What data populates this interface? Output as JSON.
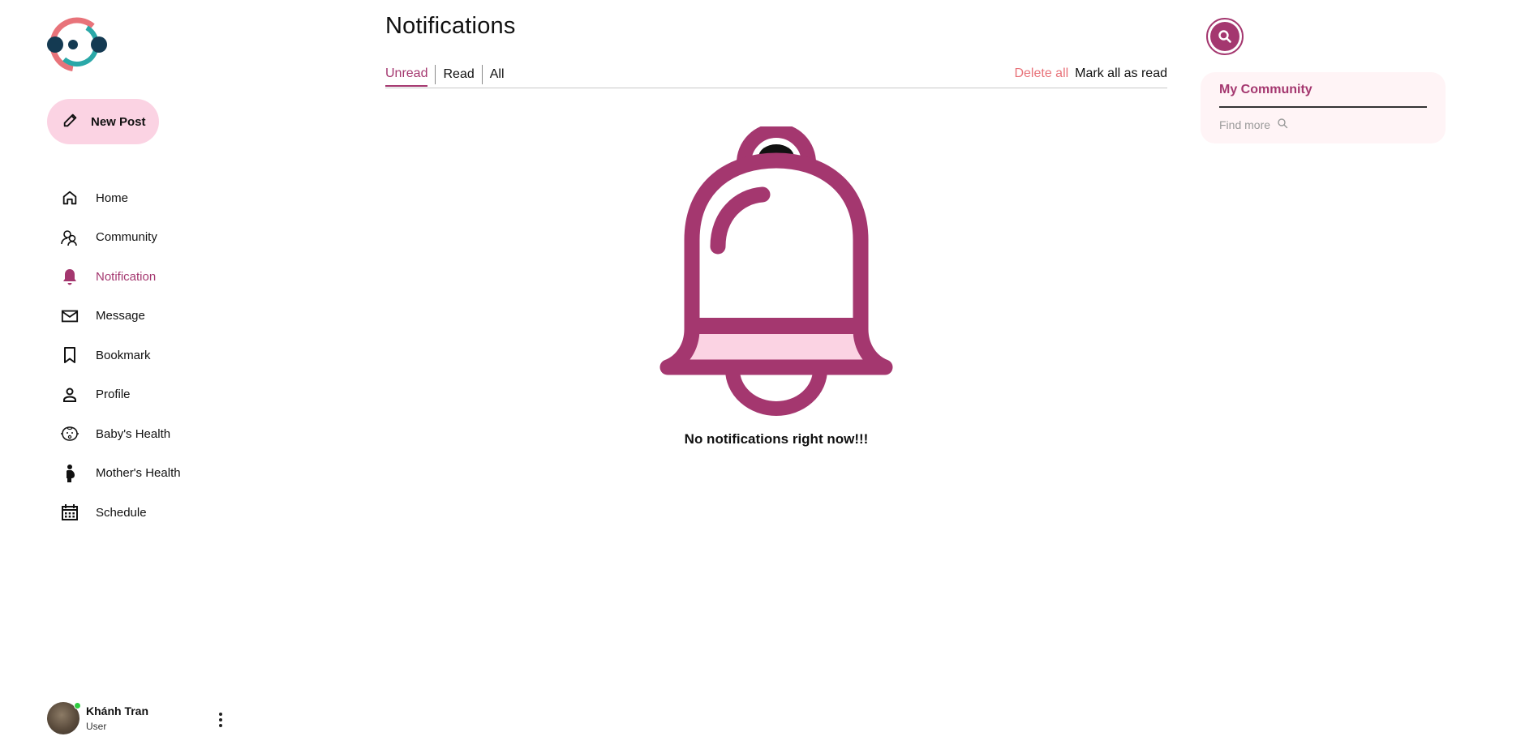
{
  "sidebar": {
    "new_post_label": "New Post",
    "items": [
      {
        "label": "Home",
        "icon": "home-icon"
      },
      {
        "label": "Community",
        "icon": "community-icon"
      },
      {
        "label": "Notification",
        "icon": "bell-icon",
        "active": true
      },
      {
        "label": "Message",
        "icon": "mail-icon"
      },
      {
        "label": "Bookmark",
        "icon": "bookmark-icon"
      },
      {
        "label": "Profile",
        "icon": "person-icon"
      },
      {
        "label": "Baby's Health",
        "icon": "baby-icon"
      },
      {
        "label": "Mother's Health",
        "icon": "pregnant-icon"
      },
      {
        "label": "Schedule",
        "icon": "calendar-icon"
      }
    ]
  },
  "user": {
    "name": "Khánh Tran",
    "role": "User",
    "status": "online"
  },
  "main": {
    "title": "Notifications",
    "tabs": [
      {
        "label": "Unread",
        "active": true
      },
      {
        "label": "Read"
      },
      {
        "label": "All"
      }
    ],
    "delete_all_label": "Delete all",
    "mark_all_read_label": "Mark all as read",
    "empty_message": "No notifications right now!!!"
  },
  "right_panel": {
    "community_title": "My Community",
    "find_more_label": "Find more"
  },
  "colors": {
    "accent": "#a4376f",
    "accent_light": "#fbd3e3",
    "delete": "#e8737a",
    "card_bg": "#fff4f6"
  }
}
